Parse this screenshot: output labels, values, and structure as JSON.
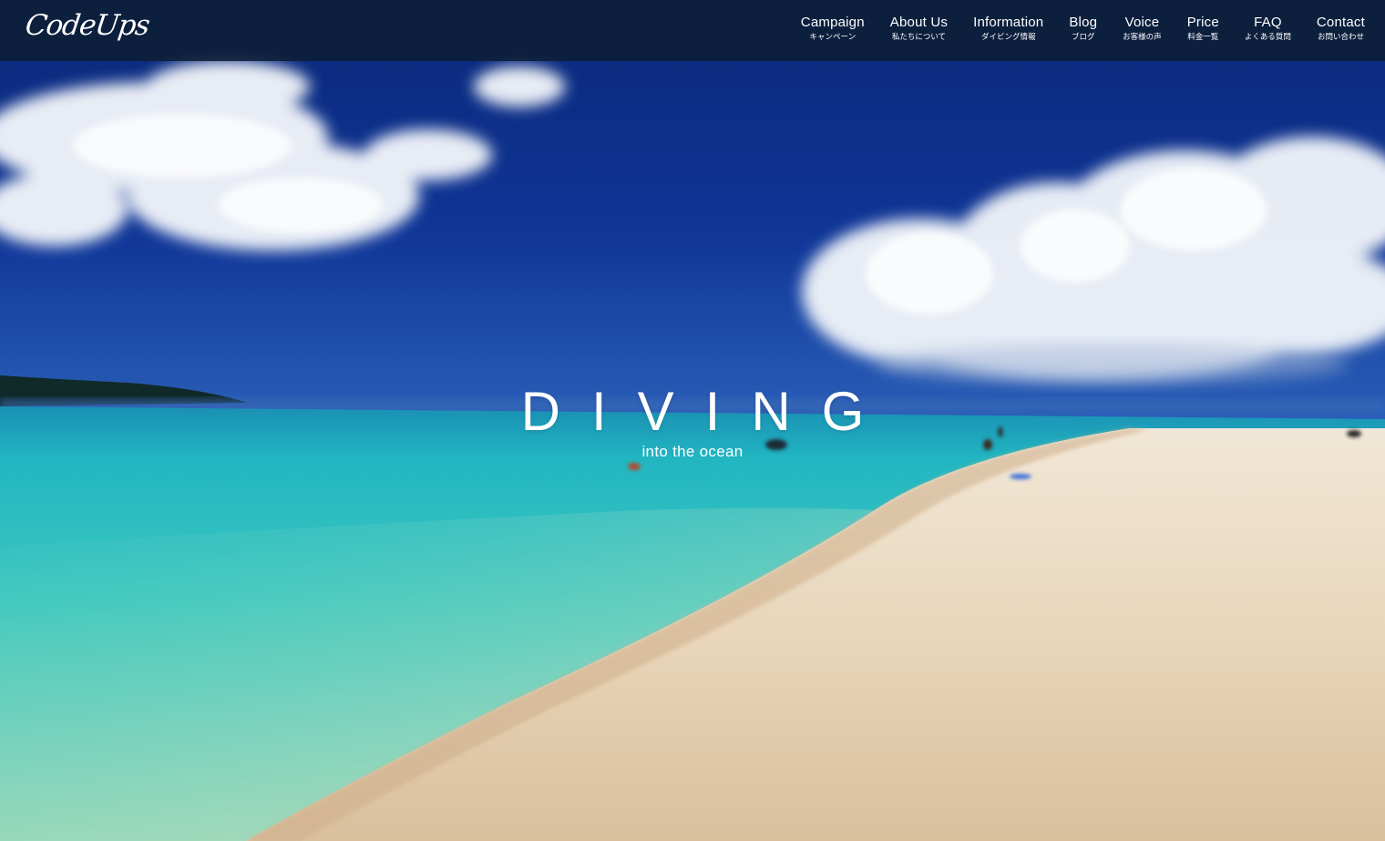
{
  "site": {
    "logo": "CodeUps"
  },
  "nav": {
    "items": [
      {
        "en": "Campaign",
        "ja": "キャンペーン"
      },
      {
        "en": "About Us",
        "ja": "私たちについて"
      },
      {
        "en": "Information",
        "ja": "ダイビング情報"
      },
      {
        "en": "Blog",
        "ja": "ブログ"
      },
      {
        "en": "Voice",
        "ja": "お客様の声"
      },
      {
        "en": "Price",
        "ja": "料金一覧"
      },
      {
        "en": "FAQ",
        "ja": "よくある質問"
      },
      {
        "en": "Contact",
        "ja": "お問い合わせ"
      }
    ]
  },
  "hero": {
    "title": "DIVING",
    "subtitle": "into the ocean"
  },
  "colors": {
    "header_bg": "#0c1e34",
    "sky_top": "#0a2a7e",
    "sea_turquoise": "#27c3c4",
    "sand": "#e9d8bf",
    "text": "#ffffff"
  }
}
